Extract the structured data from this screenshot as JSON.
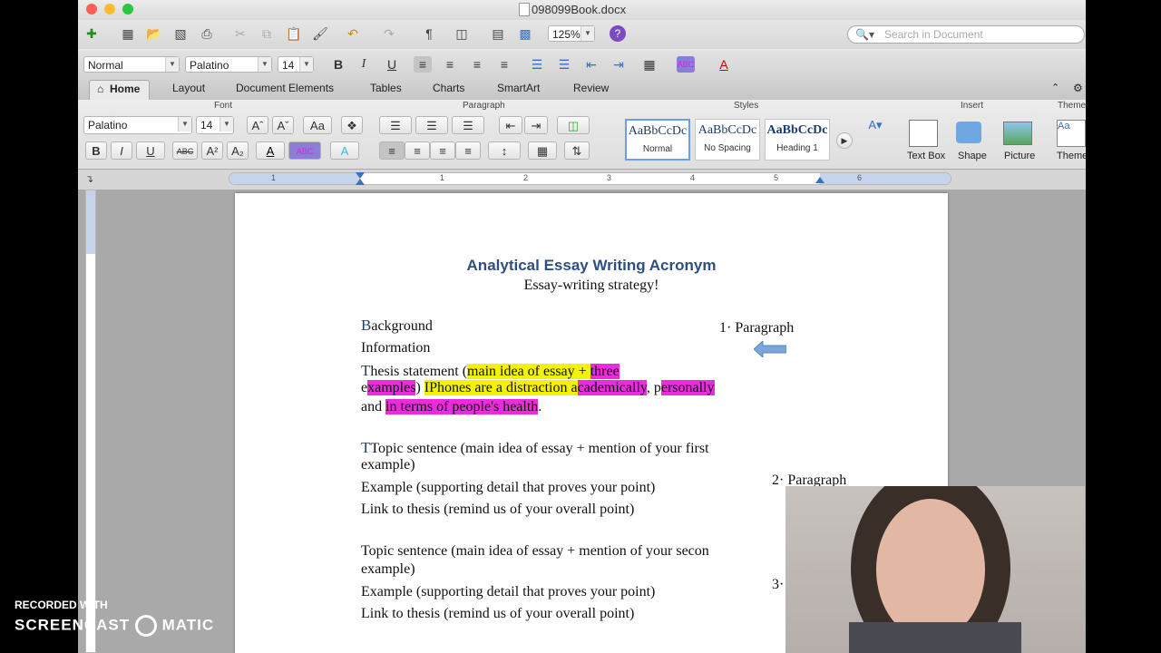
{
  "window": {
    "file_name": "098099Book.docx"
  },
  "toolbar": {
    "zoom": "125%",
    "search_placeholder": "Search in Document"
  },
  "format_bar": {
    "style": "Normal",
    "font": "Palatino",
    "size": "14"
  },
  "ribbon_tabs": [
    "Home",
    "Layout",
    "Document Elements",
    "Tables",
    "Charts",
    "SmartArt",
    "Review"
  ],
  "ribbon_groups": {
    "font": "Font",
    "paragraph": "Paragraph",
    "styles": "Styles",
    "insert": "Insert",
    "themes": "Theme"
  },
  "ribbon_font": {
    "font": "Palatino",
    "size": "14"
  },
  "styles": [
    {
      "sample": "AaBbCcDc",
      "name": "Normal"
    },
    {
      "sample": "AaBbCcDc",
      "name": "No Spacing"
    },
    {
      "sample": "AaBbCcDc",
      "name": "Heading 1"
    }
  ],
  "insert": {
    "textbox": "Text Box",
    "shape": "Shape",
    "picture": "Picture",
    "themes": "Theme"
  },
  "ruler_numbers": [
    "1",
    "1",
    "2",
    "3",
    "4",
    "5",
    "6"
  ],
  "document": {
    "title": "Analytical Essay Writing Acronym",
    "subtitle": "Essay-writing strategy!",
    "background_first": "B",
    "background_rest": "ackground",
    "information": "Information",
    "thesis_first": "T",
    "thesis_plain": "hesis statement (",
    "thesis_hl1": "main idea of essay + ",
    "thesis_hl2": "three",
    "ex_plain1": "e",
    "ex_hl": "xamples",
    "ex_plain2": ") ",
    "ex_hl2": "IPhones are a distraction a",
    "ex_hl3": "cademically",
    "ex_plain3": ", p",
    "ex_hl4": "ersonally",
    "and_plain": "and ",
    "and_hl": "in terms of people's health",
    "and_dot": ".",
    "para1_note": "1· Paragraph",
    "para2_note": "2· Paragraph",
    "para3_note": "3·",
    "topic1_a": "Topic sentence (main idea of essay + mention of your first",
    "topic1_b": "example)",
    "example1": "Example (supporting detail that proves your point)",
    "link1": "Link to thesis (remind us of your overall point)",
    "topic2_a": "Topic sentence (main idea of essay + mention of your secon",
    "topic2_b": "example)",
    "example2": "Example (supporting detail that proves your point)",
    "link2": "Link to thesis (remind us of your overall point)"
  },
  "watermark": {
    "line1": "RECORDED WITH",
    "line2": "SCREENCAST",
    "line3": "MATIC"
  }
}
